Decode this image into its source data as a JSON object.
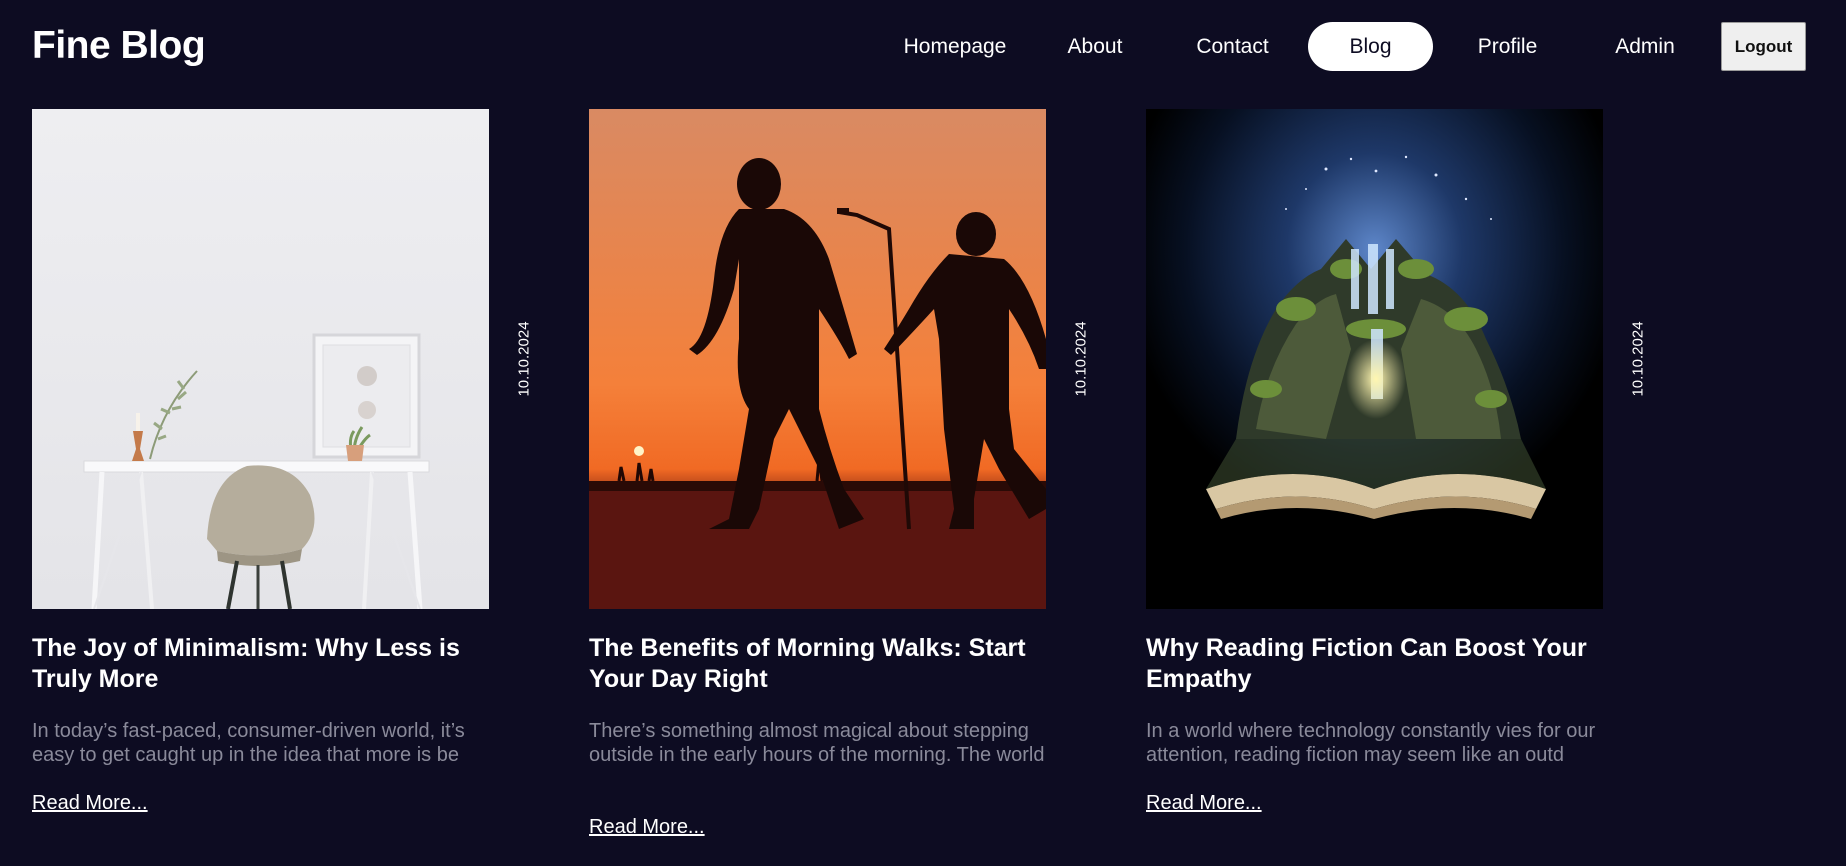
{
  "site": {
    "title": "Fine Blog"
  },
  "nav": {
    "items": [
      {
        "label": "Homepage"
      },
      {
        "label": "About"
      },
      {
        "label": "Contact"
      },
      {
        "label": "Blog",
        "active": true
      },
      {
        "label": "Profile"
      },
      {
        "label": "Admin"
      }
    ],
    "logout_label": "Logout"
  },
  "posts": [
    {
      "date": "10.10.2024",
      "title": "The Joy of Minimalism: Why Less is Truly More",
      "excerpt": "In today’s fast-paced, consumer-driven world, it’s easy to get caught up in the idea that more is be",
      "read_more": "Read More...",
      "image": "white room with desk, chair, framed picture and plant"
    },
    {
      "date": "10.10.2024",
      "title": "The Benefits of Morning Walks: Start Your Day Right",
      "excerpt": "There’s something almost magical about stepping outside in the early hours of the morning. The world",
      "read_more": "Read More...",
      "image": "silhouettes of two people walking at sunrise"
    },
    {
      "date": "10.10.2024",
      "title": "Why Reading Fiction Can Boost Your Empathy",
      "excerpt": "In a world where technology constantly vies for our attention, reading fiction may seem like an outd",
      "read_more": "Read More...",
      "image": "open book with a fantasy landscape and waterfalls rising from its pages"
    }
  ],
  "colors": {
    "background": "#0d0c22",
    "text": "#ffffff",
    "muted_text": "#8a8a9a",
    "active_nav_bg": "#ffffff"
  }
}
